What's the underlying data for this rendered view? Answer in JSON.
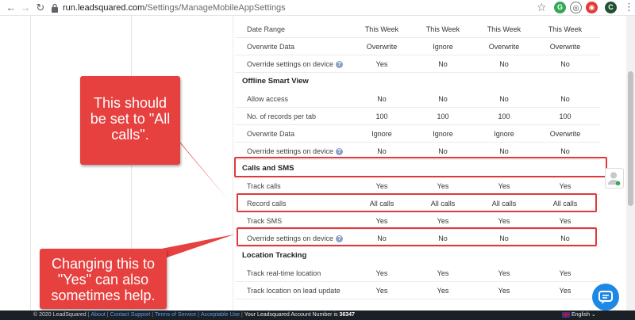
{
  "browser": {
    "url_domain": "run.leadsquared.com",
    "url_path": "/Settings/ManageMobileAppSettings",
    "profile_letter": "C"
  },
  "settings": {
    "columns_x": [
      155,
      232,
      309,
      386
    ],
    "rows_top": [
      {
        "label": "Date Range",
        "values": [
          "This Week",
          "This Week",
          "This Week",
          "This Week"
        ],
        "help": false
      },
      {
        "label": "Overwrite Data",
        "values": [
          "Overwrite",
          "Ignore",
          "Overwrite",
          "Overwrite"
        ],
        "help": false
      },
      {
        "label": "Override settings on device",
        "values": [
          "Yes",
          "No",
          "No",
          "No"
        ],
        "help": true
      }
    ],
    "section_offline": "Offline Smart View",
    "rows_offline": [
      {
        "label": "Allow access",
        "values": [
          "No",
          "No",
          "No",
          "No"
        ],
        "help": false
      },
      {
        "label": "No. of records per tab",
        "values": [
          "100",
          "100",
          "100",
          "100"
        ],
        "help": false
      },
      {
        "label": "Overwrite Data",
        "values": [
          "Ignore",
          "Ignore",
          "Ignore",
          "Overwrite"
        ],
        "help": false
      },
      {
        "label": "Override settings on device",
        "values": [
          "No",
          "No",
          "No",
          "No"
        ],
        "help": true
      }
    ],
    "section_calls": "Calls and SMS",
    "rows_calls": [
      {
        "label": "Track calls",
        "values": [
          "Yes",
          "Yes",
          "Yes",
          "Yes"
        ],
        "help": false
      },
      {
        "label": "Record calls",
        "values": [
          "All calls",
          "All calls",
          "All calls",
          "All calls"
        ],
        "help": false
      },
      {
        "label": "Track SMS",
        "values": [
          "Yes",
          "Yes",
          "Yes",
          "Yes"
        ],
        "help": false
      },
      {
        "label": "Override settings on device",
        "values": [
          "No",
          "No",
          "No",
          "No"
        ],
        "help": true
      }
    ],
    "section_location": "Location Tracking",
    "rows_location": [
      {
        "label": "Track real-time location",
        "values": [
          "Yes",
          "Yes",
          "Yes",
          "Yes"
        ],
        "help": false
      },
      {
        "label": "Track location on lead update",
        "values": [
          "Yes",
          "Yes",
          "Yes",
          "Yes"
        ],
        "help": false
      }
    ]
  },
  "callouts": {
    "top_line1": "This should",
    "top_line2": "be set to \"All",
    "top_line3": "calls\".",
    "bottom_line1": "Changing this to",
    "bottom_line2": "\"Yes\" can also",
    "bottom_line3": "sometimes help."
  },
  "footer": {
    "copyright": "© 2020 LeadSquared",
    "about": "About",
    "contact": "Contact Support",
    "terms": "Terms of Service",
    "acceptable": "Acceptable Use",
    "account_text": "Your Leadsquared Account Number is",
    "account_number": "36347",
    "language": "English"
  },
  "colors": {
    "highlight": "#e0393b",
    "callout": "#e6403f",
    "chat": "#1e88e5",
    "footer_bg": "#1b1f26"
  }
}
